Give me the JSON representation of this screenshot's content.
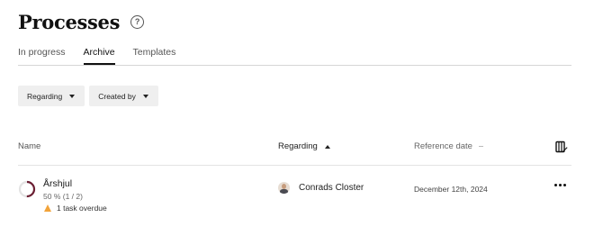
{
  "page": {
    "title": "Processes",
    "help_icon": "question-circle-icon"
  },
  "tabs": [
    {
      "label": "In progress",
      "active": false
    },
    {
      "label": "Archive",
      "active": true
    },
    {
      "label": "Templates",
      "active": false
    }
  ],
  "filters": [
    {
      "label": "Regarding",
      "icon": "caret-down-icon"
    },
    {
      "label": "Created by",
      "icon": "caret-down-icon"
    }
  ],
  "table": {
    "columns": {
      "name": "Name",
      "regarding": "Regarding",
      "reference_date": "Reference date"
    },
    "sort": {
      "column": "regarding",
      "direction": "ascending"
    },
    "columns_icon": "edit-columns-icon",
    "rows": [
      {
        "name": "Årshjul",
        "progress_text": "50 % (1 / 2)",
        "progress_fraction": 0.5,
        "overdue_text": "1 task overdue",
        "regarding": "Conrads Closter",
        "reference_date": "December 12th, 2024",
        "menu_icon": "more-horizontal-icon"
      }
    ]
  },
  "colors": {
    "progress_ring": "#6b1f33",
    "progress_track": "#e3e3e3",
    "warning": "#f2a33a",
    "filter_bg": "#efefef"
  }
}
